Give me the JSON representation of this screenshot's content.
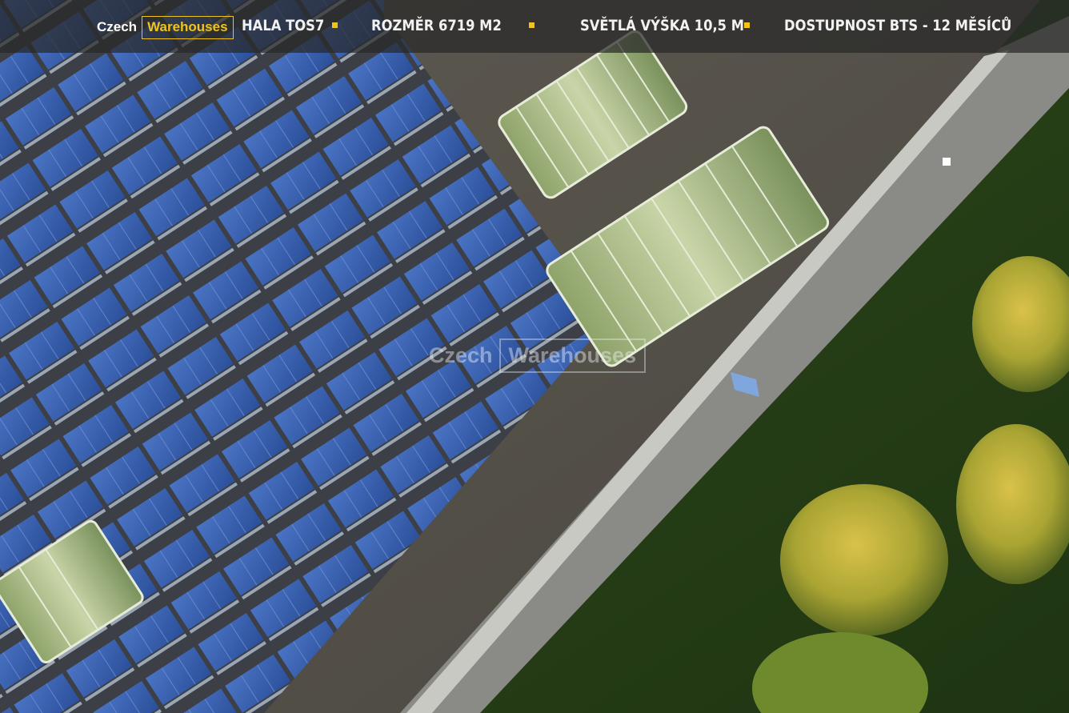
{
  "header": {
    "logo": {
      "word1": "Czech",
      "word2": "Warehouses"
    },
    "stats": [
      {
        "label": "HALA  TOS7"
      },
      {
        "label": "ROZMĚR 6719 M2"
      },
      {
        "label": "SVĚTLÁ VÝŠKA 10,5 M"
      },
      {
        "label": "DOSTUPNOST BTS - 12 MĚSÍCŮ"
      }
    ],
    "accent_color": "#f0c418"
  },
  "photo": {
    "subject": "aerial-view-warehouse-roof-solar-panels",
    "watermark": {
      "word1": "Czech",
      "word2": "Warehouses"
    }
  }
}
